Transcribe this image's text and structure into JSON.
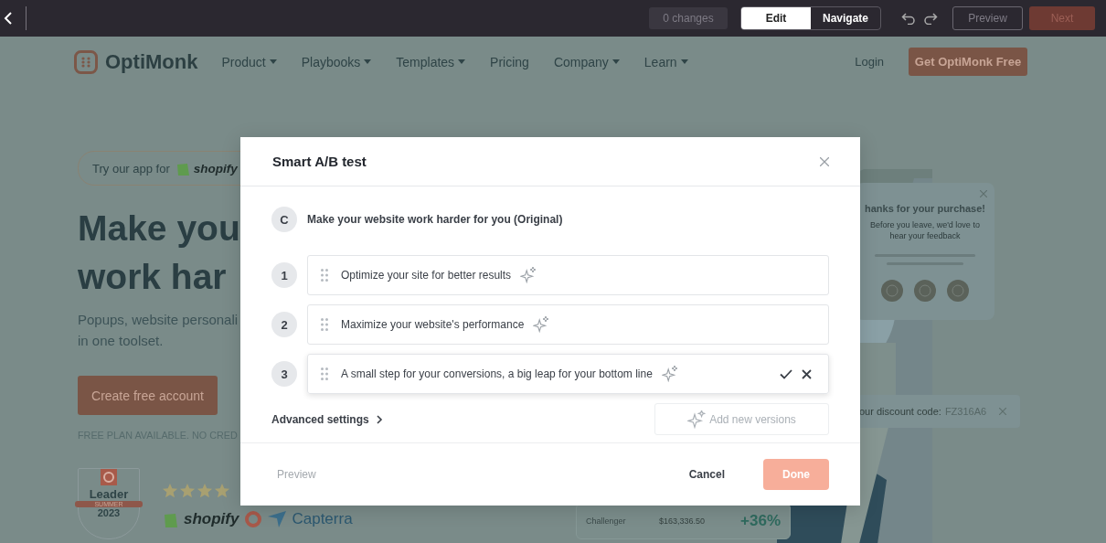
{
  "toolbar": {
    "changes": "0 changes",
    "modes": [
      {
        "label": "Edit",
        "selected": true
      },
      {
        "label": "Navigate",
        "selected": false
      }
    ],
    "preview": "Preview",
    "next": {
      "label": "Next",
      "disabled": true
    }
  },
  "site": {
    "logo": "OptiMonk",
    "nav": [
      {
        "label": "Product",
        "has_menu": true
      },
      {
        "label": "Playbooks",
        "has_menu": true
      },
      {
        "label": "Templates",
        "has_menu": true
      },
      {
        "label": "Pricing",
        "has_menu": false
      },
      {
        "label": "Company",
        "has_menu": true
      },
      {
        "label": "Learn",
        "has_menu": true
      }
    ],
    "login": "Login",
    "cta": "Get OptiMonk Free",
    "hero": {
      "app_badge": {
        "text": "Try our app for",
        "brand": "shopify"
      },
      "heading": [
        "Make you",
        "work har"
      ],
      "subtitle": [
        "Popups, website personali",
        "in one toolset."
      ],
      "button": "Create free account",
      "note": "FREE PLAN AVAILABLE. NO CRED",
      "award": {
        "title": "Leader",
        "ribbon": "SUMMER",
        "year": "2023"
      },
      "stars": 4,
      "logos": [
        "shopify",
        "Capterra"
      ]
    },
    "feedback_card": {
      "title": "hanks for your purchase!",
      "text": "Before you leave, we'd love to hear your feedback"
    },
    "discount": {
      "label": "our discount code:",
      "code": "FZ316A6"
    },
    "stat": {
      "label": "Challenger",
      "value": "$163,336.50",
      "change": "+36%"
    }
  },
  "modal": {
    "title": "Smart A/B test",
    "versions": [
      {
        "kind": "original",
        "marker": "C",
        "text": "Make your website work harder for you (Original)"
      },
      {
        "kind": "variant",
        "marker": "1",
        "text": "Optimize your site for better results",
        "editing": false
      },
      {
        "kind": "variant",
        "marker": "2",
        "text": "Maximize your website's performance",
        "editing": false
      },
      {
        "kind": "variant",
        "marker": "3",
        "text": "A small step for your conversions, a big leap for your bottom line",
        "editing": true
      }
    ],
    "advanced": "Advanced settings",
    "add": "Add new versions",
    "preview": "Preview",
    "cancel": "Cancel",
    "done": {
      "label": "Done",
      "disabled": true
    }
  }
}
